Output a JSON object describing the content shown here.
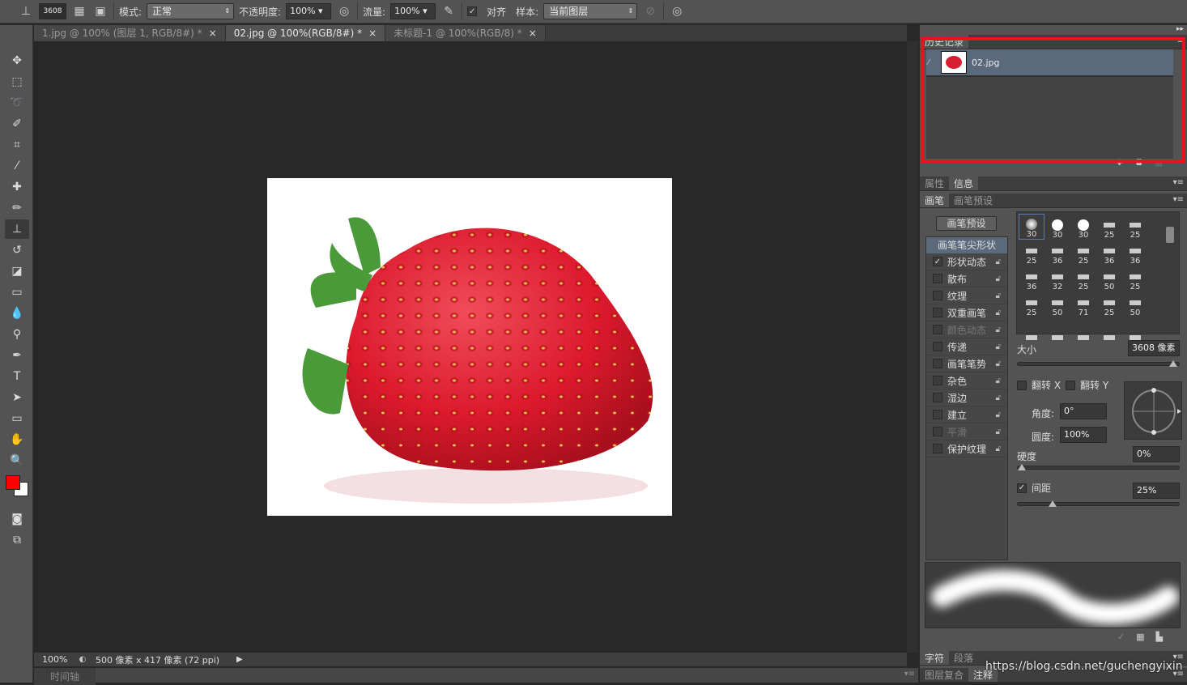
{
  "options_bar": {
    "brush_size": "3608",
    "mode_label": "模式:",
    "mode_value": "正常",
    "opacity_label": "不透明度:",
    "opacity_value": "100%",
    "flow_label": "流量:",
    "flow_value": "100%",
    "aligned_label": "对齐",
    "aligned_checked": true,
    "sample_label": "样本:",
    "sample_value": "当前图层"
  },
  "tabs": [
    {
      "label": "1.jpg @ 100% (图层 1, RGB/8#) *",
      "active": false
    },
    {
      "label": "02.jpg @ 100%(RGB/8#) *",
      "active": true
    },
    {
      "label": "未标题-1 @ 100%(RGB/8) *",
      "active": false
    }
  ],
  "tab_close": "×",
  "status": {
    "zoom": "100%",
    "doc_info": "500 像素 x 417 像素 (72 ppi)"
  },
  "timeline": {
    "label": "时间轴"
  },
  "history": {
    "tab": "历史记录",
    "items": [
      {
        "name": "02.jpg"
      }
    ]
  },
  "info_tabs": [
    "属性",
    "信息"
  ],
  "brush_tabs": [
    "画笔",
    "画笔预设"
  ],
  "brush": {
    "preset_button": "画笔预设",
    "tip_shape": "画笔笔尖形状",
    "options": [
      {
        "label": "形状动态",
        "checked": true,
        "enabled": true
      },
      {
        "label": "散布",
        "checked": false,
        "enabled": true
      },
      {
        "label": "纹理",
        "checked": false,
        "enabled": true
      },
      {
        "label": "双重画笔",
        "checked": false,
        "enabled": true
      },
      {
        "label": "颜色动态",
        "checked": false,
        "enabled": false
      },
      {
        "label": "传递",
        "checked": false,
        "enabled": true
      },
      {
        "label": "画笔笔势",
        "checked": false,
        "enabled": true
      },
      {
        "label": "杂色",
        "checked": false,
        "enabled": true
      },
      {
        "label": "湿边",
        "checked": false,
        "enabled": true
      },
      {
        "label": "建立",
        "checked": false,
        "enabled": true
      },
      {
        "label": "平滑",
        "checked": false,
        "enabled": false
      },
      {
        "label": "保护纹理",
        "checked": false,
        "enabled": true
      }
    ],
    "tips": [
      "30",
      "30",
      "30",
      "25",
      "25",
      "25",
      "36",
      "25",
      "36",
      "36",
      "36",
      "32",
      "25",
      "50",
      "25",
      "25",
      "50",
      "71",
      "25",
      "50",
      "",
      "",
      "",
      "",
      ""
    ],
    "size_label": "大小",
    "size_value": "3608 像素",
    "size_fraction": 0.98,
    "flip_x": "翻转 X",
    "flip_y": "翻转 Y",
    "angle_label": "角度:",
    "angle_value": "0°",
    "roundness_label": "圆度:",
    "roundness_value": "100%",
    "hardness_label": "硬度",
    "hardness_value": "0%",
    "hardness_fraction": 0,
    "spacing_label": "间距",
    "spacing_checked": true,
    "spacing_value": "25%",
    "spacing_fraction": 0.12
  },
  "char_tabs": [
    "字符",
    "段落"
  ],
  "comp_tabs": [
    "图层复合",
    "注释"
  ],
  "watermark": "https://blog.csdn.net/guchengyixin",
  "colors": {
    "foreground": "#ff0000",
    "background": "#ffffff",
    "highlight": "#e8141c"
  }
}
